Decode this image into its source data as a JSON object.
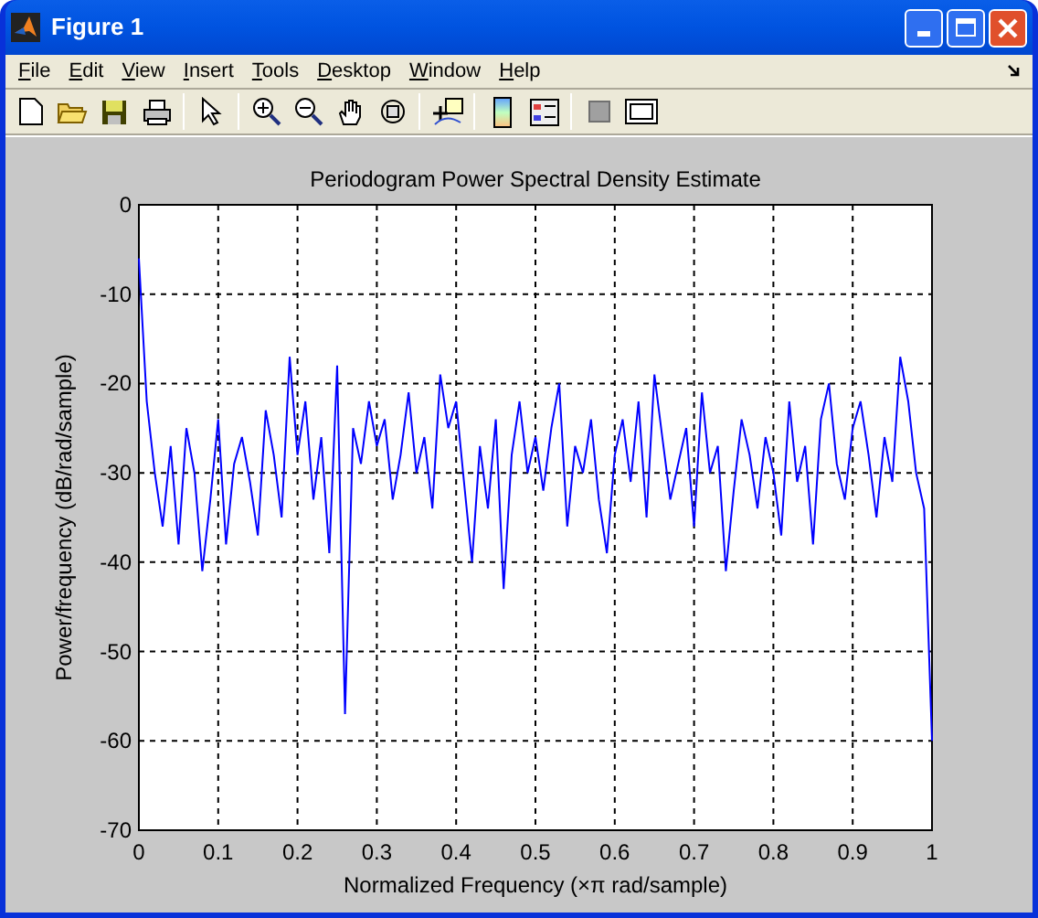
{
  "window": {
    "title": "Figure 1"
  },
  "menu": [
    "File",
    "Edit",
    "View",
    "Insert",
    "Tools",
    "Desktop",
    "Window",
    "Help"
  ],
  "plot": {
    "chart_data": {
      "type": "line",
      "title": "Periodogram Power Spectral Density Estimate",
      "xlabel": "Normalized Frequency  (×π rad/sample)",
      "ylabel": "Power/frequency (dB/rad/sample)",
      "grid": true,
      "xlim": [
        0,
        1
      ],
      "ylim": [
        -70,
        0
      ],
      "xticks": [
        0,
        0.1,
        0.2,
        0.3,
        0.4,
        0.5,
        0.6,
        0.7,
        0.8,
        0.9,
        1
      ],
      "yticks": [
        0,
        -10,
        -20,
        -30,
        -40,
        -50,
        -60,
        -70
      ],
      "x": [
        0,
        0.01,
        0.02,
        0.03,
        0.04,
        0.05,
        0.06,
        0.07,
        0.08,
        0.09,
        0.1,
        0.11,
        0.12,
        0.13,
        0.14,
        0.15,
        0.16,
        0.17,
        0.18,
        0.19,
        0.2,
        0.21,
        0.22,
        0.23,
        0.24,
        0.25,
        0.26,
        0.27,
        0.28,
        0.29,
        0.3,
        0.31,
        0.32,
        0.33,
        0.34,
        0.35,
        0.36,
        0.37,
        0.38,
        0.39,
        0.4,
        0.41,
        0.42,
        0.43,
        0.44,
        0.45,
        0.46,
        0.47,
        0.48,
        0.49,
        0.5,
        0.51,
        0.52,
        0.53,
        0.54,
        0.55,
        0.56,
        0.57,
        0.58,
        0.59,
        0.6,
        0.61,
        0.62,
        0.63,
        0.64,
        0.65,
        0.66,
        0.67,
        0.68,
        0.69,
        0.7,
        0.71,
        0.72,
        0.73,
        0.74,
        0.75,
        0.76,
        0.77,
        0.78,
        0.79,
        0.8,
        0.81,
        0.82,
        0.83,
        0.84,
        0.85,
        0.86,
        0.87,
        0.88,
        0.89,
        0.9,
        0.91,
        0.92,
        0.93,
        0.94,
        0.95,
        0.96,
        0.97,
        0.98,
        0.99,
        1
      ],
      "series": [
        {
          "color": "#0000ff",
          "values": [
            -6,
            -22,
            -30,
            -36,
            -27,
            -38,
            -25,
            -30,
            -41,
            -33,
            -24,
            -38,
            -29,
            -26,
            -31,
            -37,
            -23,
            -28,
            -35,
            -17,
            -28,
            -22,
            -33,
            -26,
            -39,
            -18,
            -57,
            -25,
            -29,
            -22,
            -27,
            -24,
            -33,
            -28,
            -21,
            -30,
            -26,
            -34,
            -19,
            -25,
            -22,
            -31,
            -40,
            -27,
            -34,
            -24,
            -43,
            -28,
            -22,
            -30,
            -26,
            -32,
            -25,
            -20,
            -36,
            -27,
            -30,
            -24,
            -33,
            -39,
            -28,
            -24,
            -31,
            -22,
            -35,
            -19,
            -26,
            -33,
            -29,
            -25,
            -36,
            -21,
            -30,
            -27,
            -41,
            -32,
            -24,
            -28,
            -34,
            -26,
            -30,
            -37,
            -22,
            -31,
            -27,
            -38,
            -24,
            -20,
            -29,
            -33,
            -25,
            -22,
            -28,
            -35,
            -26,
            -31,
            -17,
            -22,
            -30,
            -34,
            -60
          ]
        }
      ]
    }
  }
}
